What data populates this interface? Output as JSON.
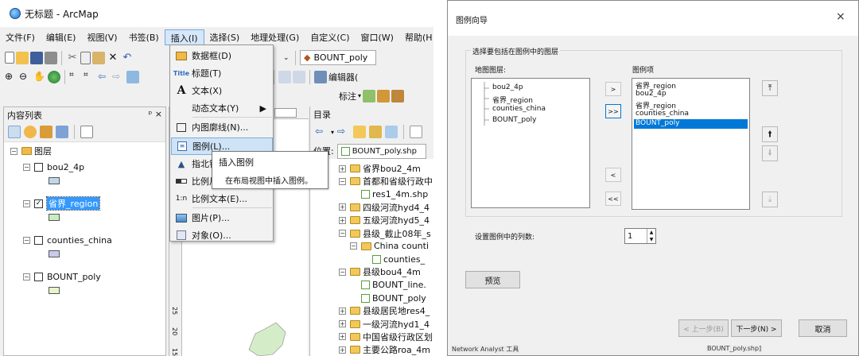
{
  "arcmap": {
    "title": "无标题 - ArcMap",
    "menu": [
      "文件(F)",
      "编辑(E)",
      "视图(V)",
      "书签(B)",
      "插入(I)",
      "选择(S)",
      "地理处理(G)",
      "自定义(C)",
      "窗口(W)",
      "帮助(H"
    ],
    "layer_combo": "BOUNT_poly",
    "editor_label": "编辑器(",
    "annot_label": "标注",
    "toc": {
      "title": "内容列表",
      "pin": "ᵖ ×",
      "root": "图层",
      "layers": [
        {
          "name": "bou2_4p",
          "checked": false,
          "color": "#bfd8ee"
        },
        {
          "name": "省界_region",
          "checked": true,
          "color": "#c9ecc3"
        },
        {
          "name": "counties_china",
          "checked": false,
          "color": "#c9c9ee"
        },
        {
          "name": "BOUNT_poly",
          "checked": false,
          "color": "#e8f5c8"
        }
      ]
    },
    "ruler_labels": [
      "15",
      "20",
      "25"
    ],
    "catalog": {
      "title": "目录",
      "location_label": "位置:",
      "location_value": "BOUNT_poly.shp",
      "items": [
        {
          "text": "省界bou2_4m",
          "depth": 0,
          "type": "folder",
          "exp": "+"
        },
        {
          "text": "首都和省级行政中",
          "depth": 0,
          "type": "folder",
          "exp": "-"
        },
        {
          "text": "res1_4m.shp",
          "depth": 1,
          "type": "file",
          "exp": ""
        },
        {
          "text": "四级河流hyd4_4",
          "depth": 0,
          "type": "folder",
          "exp": "+"
        },
        {
          "text": "五级河流hyd5_4",
          "depth": 0,
          "type": "folder",
          "exp": "+"
        },
        {
          "text": "县级_截止08年_s",
          "depth": 0,
          "type": "folder",
          "exp": "-"
        },
        {
          "text": "China counti",
          "depth": 1,
          "type": "folder",
          "exp": "-"
        },
        {
          "text": "counties_",
          "depth": 2,
          "type": "file",
          "exp": ""
        },
        {
          "text": "县级bou4_4m",
          "depth": 0,
          "type": "folder",
          "exp": "-"
        },
        {
          "text": "BOUNT_line.",
          "depth": 1,
          "type": "file",
          "exp": ""
        },
        {
          "text": "BOUNT_poly",
          "depth": 1,
          "type": "file",
          "exp": ""
        },
        {
          "text": "县级居民地res4_",
          "depth": 0,
          "type": "folder",
          "exp": "+"
        },
        {
          "text": "一级河流hyd1_4",
          "depth": 0,
          "type": "folder",
          "exp": "+"
        },
        {
          "text": "中国省级行政区划",
          "depth": 0,
          "type": "folder",
          "exp": "+"
        },
        {
          "text": "主要公路roa_4m",
          "depth": 0,
          "type": "folder",
          "exp": "+"
        }
      ]
    },
    "insert_menu": [
      {
        "label": "数据框(D)",
        "icon": "data-frame-icon",
        "arrow": false
      },
      {
        "label": "标题(T)",
        "icon": "title-icon",
        "arrow": false
      },
      {
        "label": "文本(X)",
        "icon": "text-icon",
        "arrow": false
      },
      {
        "label": "动态文本(Y)",
        "icon": "",
        "arrow": true
      },
      {
        "label": "内图廓线(N)...",
        "icon": "neatline-icon",
        "arrow": false
      },
      {
        "label": "图例(L)...",
        "icon": "legend-icon",
        "arrow": false
      },
      {
        "label": "指北针",
        "icon": "north-arrow-icon",
        "arrow": false
      },
      {
        "label": "比例尺",
        "icon": "scale-bar-icon",
        "arrow": false
      },
      {
        "label": "比例文本(E)...",
        "icon": "scale-text-icon",
        "arrow": false
      },
      {
        "label": "图片(P)...",
        "icon": "picture-icon",
        "arrow": false
      },
      {
        "label": "对象(O)...",
        "icon": "object-icon",
        "arrow": false
      }
    ],
    "tooltip": {
      "title": "插入图例",
      "desc": "在布局视图中插入图例。"
    }
  },
  "wizard": {
    "title": "图例向导",
    "close": "×",
    "group_label": "选择要包括在图例中的图层",
    "map_layers_label": "地图图层:",
    "map_layers": [
      "bou2_4p",
      "省界_region",
      "counties_china",
      "BOUNT_poly"
    ],
    "legend_items_label": "图例项",
    "legend_items": [
      "省界_region",
      "bou2_4p",
      "省界_region",
      "counties_china",
      "BOUNT_poly"
    ],
    "selected_legend_index": 4,
    "buttons_mid": [
      ">",
      ">>",
      "<",
      "<<"
    ],
    "columns_label": "设置图例中的列数:",
    "columns_value": "1",
    "preview": "预览",
    "back": "< 上一步(B)",
    "next": "下一步(N) >",
    "cancel": "取消",
    "behind_text_left": "Network Analyst 工具",
    "behind_text_right": "BOUNT_poly.shp]"
  }
}
